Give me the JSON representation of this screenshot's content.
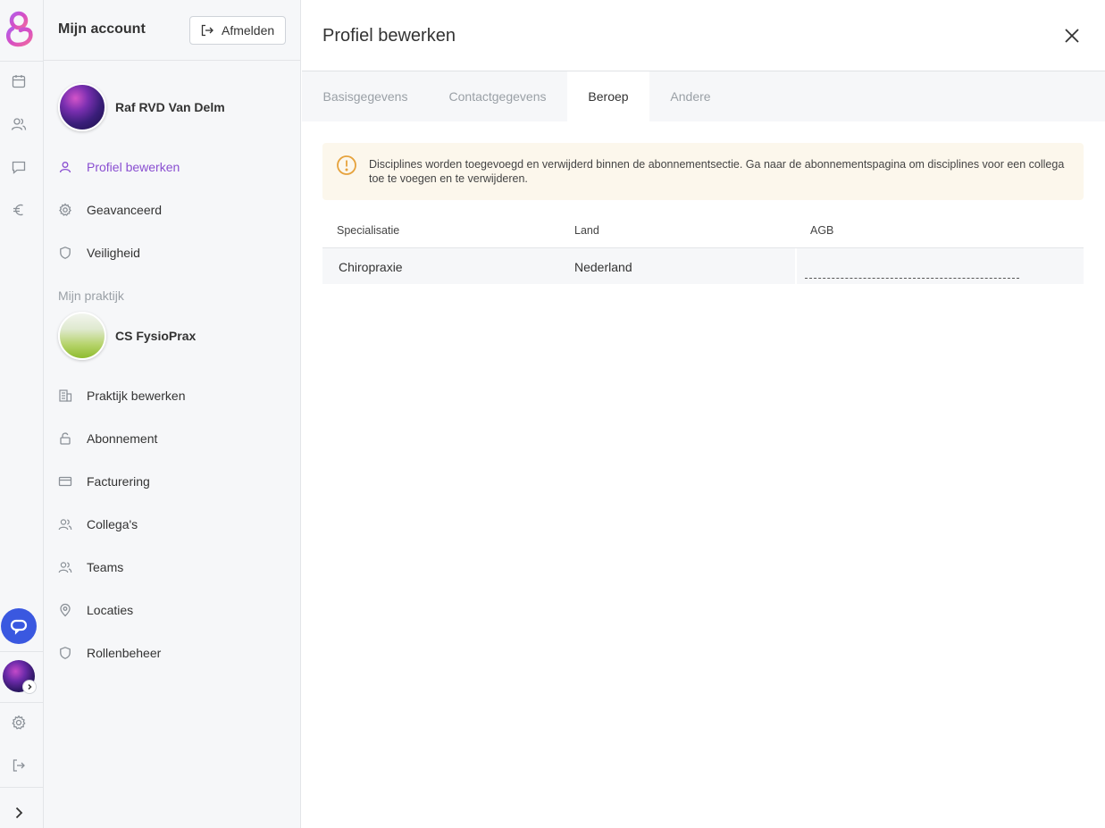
{
  "rail": {
    "icons": [
      "calendar-icon",
      "users-icon",
      "chat-icon",
      "euro-icon",
      "settings-icon",
      "logout-icon",
      "expand-icon"
    ]
  },
  "panel": {
    "title": "Mijn account",
    "logout_label": "Afmelden",
    "user_name": "Raf RVD Van Delm",
    "account_items": [
      {
        "label": "Profiel bewerken",
        "icon": "user-icon",
        "active": true
      },
      {
        "label": "Geavanceerd",
        "icon": "gear-icon",
        "active": false
      },
      {
        "label": "Veiligheid",
        "icon": "shield-icon",
        "active": false
      }
    ],
    "practice_section_label": "Mijn praktijk",
    "practice_name": "CS FysioPrax",
    "practice_items": [
      {
        "label": "Praktijk bewerken",
        "icon": "building-icon"
      },
      {
        "label": "Abonnement",
        "icon": "unlock-icon"
      },
      {
        "label": "Facturering",
        "icon": "credit-card-icon"
      },
      {
        "label": "Collega's",
        "icon": "users-icon"
      },
      {
        "label": "Teams",
        "icon": "users-icon"
      },
      {
        "label": "Locaties",
        "icon": "map-pin-icon"
      },
      {
        "label": "Rollenbeheer",
        "icon": "shield-icon"
      }
    ]
  },
  "main": {
    "title": "Profiel bewerken",
    "tabs": [
      {
        "label": "Basisgegevens",
        "active": false
      },
      {
        "label": "Contactgegevens",
        "active": false
      },
      {
        "label": "Beroep",
        "active": true
      },
      {
        "label": "Andere",
        "active": false
      }
    ],
    "alert": {
      "text": "Disciplines worden toegevoegd en verwijderd binnen de abonnementsectie. Ga naar de abonnementspagina om disciplines voor een collega toe te voegen en te verwijderen.",
      "color": "#e6a23c"
    },
    "table": {
      "headers": [
        "Specialisatie",
        "Land",
        "AGB"
      ],
      "rows": [
        {
          "specialisatie": "Chiropraxie",
          "land": "Nederland",
          "agb": ""
        }
      ]
    }
  },
  "colors": {
    "accent": "#8a4fd1",
    "chat_button": "#3a58e0",
    "alert_bg": "#fcf7ec"
  }
}
